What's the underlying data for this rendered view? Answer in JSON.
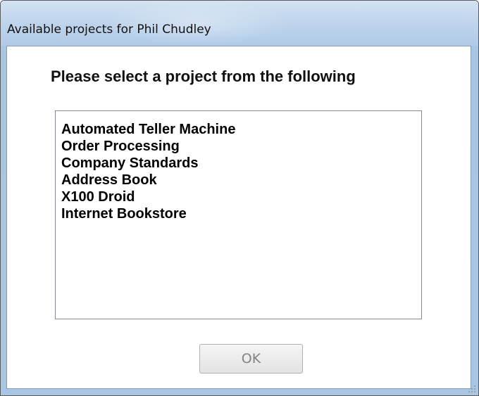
{
  "window": {
    "title": "Available projects for Phil Chudley"
  },
  "dialog": {
    "prompt": "Please select a project from the following",
    "projects": [
      "Automated Teller Machine",
      "Order Processing",
      "Company Standards",
      "Address Book",
      "X100 Droid",
      "Internet Bookstore"
    ],
    "ok_label": "OK",
    "ok_enabled": false
  },
  "icons": {
    "resize_grip": "size-grip-icon"
  }
}
